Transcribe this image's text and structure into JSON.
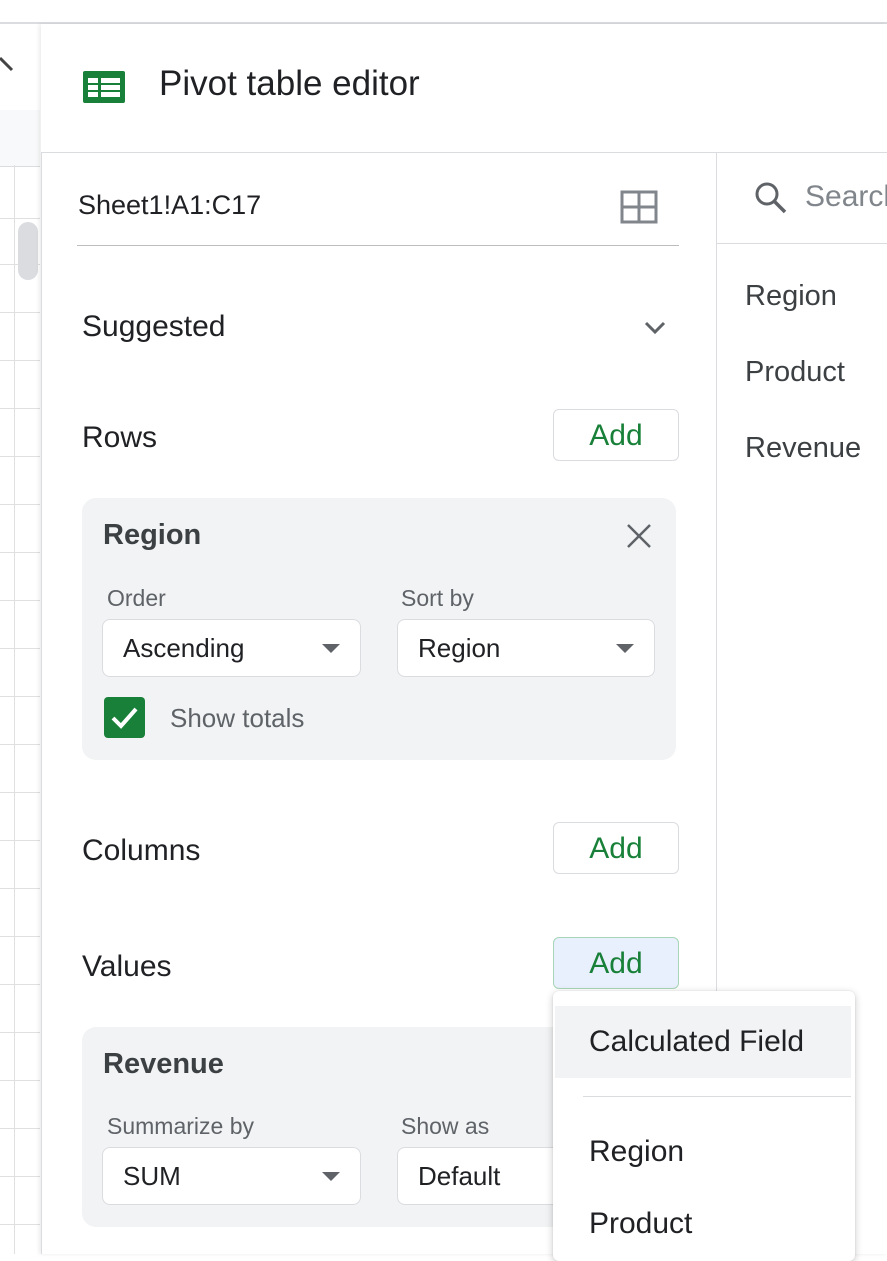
{
  "panel": {
    "title": "Pivot table editor",
    "range": "Sheet1!A1:C17"
  },
  "suggested": {
    "label": "Suggested"
  },
  "rows": {
    "label": "Rows",
    "add_label": "Add",
    "card": {
      "title": "Region",
      "order_label": "Order",
      "order_value": "Ascending",
      "sortby_label": "Sort by",
      "sortby_value": "Region",
      "show_totals_label": "Show totals",
      "show_totals_checked": true
    }
  },
  "columns": {
    "label": "Columns",
    "add_label": "Add"
  },
  "values": {
    "label": "Values",
    "add_label": "Add",
    "card": {
      "title": "Revenue",
      "summarize_label": "Summarize by",
      "summarize_value": "SUM",
      "showas_label": "Show as",
      "showas_value": "Default"
    }
  },
  "fields": {
    "search_placeholder": "Search",
    "items": [
      "Region",
      "Product",
      "Revenue"
    ]
  },
  "menu": {
    "items": [
      "Calculated Field",
      "Region",
      "Product"
    ]
  },
  "colors": {
    "accent_green": "#188038",
    "card_bg": "#f1f3f4"
  }
}
